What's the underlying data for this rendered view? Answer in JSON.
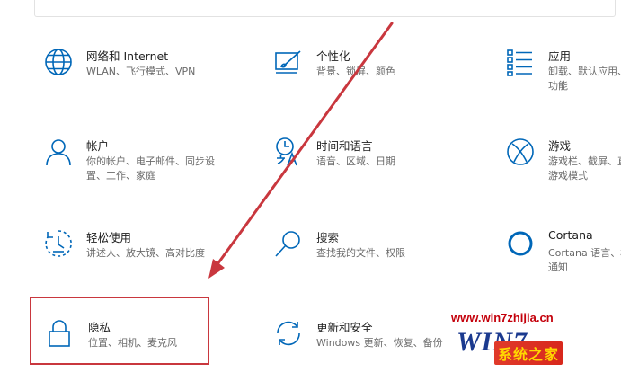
{
  "tiles": [
    {
      "id": "network",
      "title": "网络和 Internet",
      "desc": "WLAN、飞行模式、VPN"
    },
    {
      "id": "personalization",
      "title": "个性化",
      "desc": "背景、锁屏、颜色"
    },
    {
      "id": "apps",
      "title": "应用",
      "desc": "卸载、默认应用、可选功能"
    },
    {
      "id": "accounts",
      "title": "帐户",
      "desc": "你的帐户、电子邮件、同步设置、工作、家庭"
    },
    {
      "id": "time-language",
      "title": "时间和语言",
      "desc": "语音、区域、日期"
    },
    {
      "id": "gaming",
      "title": "游戏",
      "desc": "游戏栏、截屏、直播、游戏模式"
    },
    {
      "id": "ease-of-access",
      "title": "轻松使用",
      "desc": "讲述人、放大镜、高对比度"
    },
    {
      "id": "search",
      "title": "搜索",
      "desc": "查找我的文件、权限"
    },
    {
      "id": "cortana",
      "title": "Cortana",
      "desc": "Cortana 语言、权限、通知"
    },
    {
      "id": "privacy",
      "title": "隐私",
      "desc": "位置、相机、麦克风"
    },
    {
      "id": "update-security",
      "title": "更新和安全",
      "desc": "Windows 更新、恢复、备份"
    }
  ],
  "watermark": {
    "url": "www.win7zhijia.cn",
    "brand": "WIN7",
    "cn": "系统之家"
  },
  "colors": {
    "accent": "#0067b8",
    "highlight": "#c9373e"
  }
}
